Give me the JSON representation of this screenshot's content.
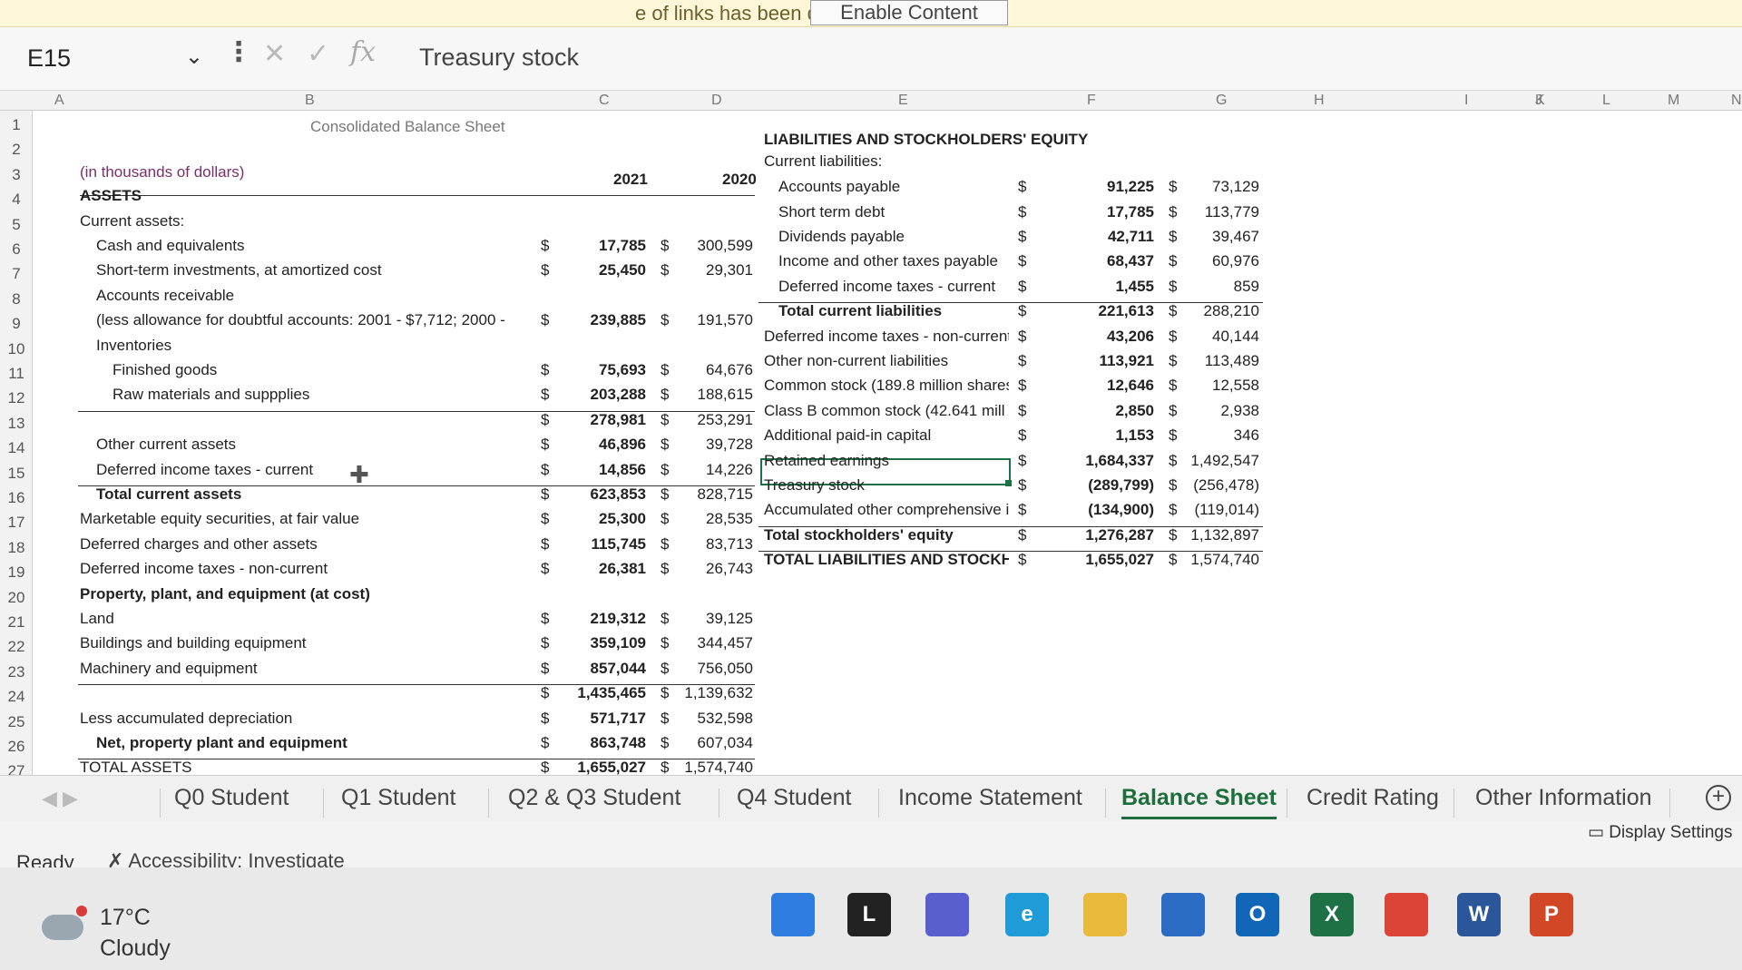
{
  "security_bar": {
    "message": "e of links has been disabled",
    "button": "Enable Content"
  },
  "formula_bar": {
    "name_box": "E15",
    "chevron": "⌄",
    "dots": "⋮",
    "cancel": "✕",
    "enter": "✓",
    "fx": "fx",
    "formula": "Treasury stock"
  },
  "columns": [
    "A",
    "B",
    "C",
    "D",
    "E",
    "F",
    "G",
    "H",
    "I",
    "J",
    "K",
    "L",
    "M",
    "N"
  ],
  "rows": [
    "1",
    "2",
    "3",
    "4",
    "5",
    "6",
    "7",
    "8",
    "9",
    "10",
    "11",
    "12",
    "13",
    "14",
    "15",
    "16",
    "17",
    "18",
    "19",
    "20",
    "21",
    "22",
    "23",
    "24",
    "25",
    "26",
    "27"
  ],
  "assets": {
    "title": "Consolidated Balance Sheet",
    "units": "(in thousands of dollars)",
    "year1": "2021",
    "year2": "2020",
    "lines": [
      {
        "label": "ASSETS",
        "bold": true,
        "indent": 0,
        "v1": "",
        "v2": ""
      },
      {
        "label": "Current assets:",
        "bold": false,
        "indent": 0,
        "v1": "",
        "v2": ""
      },
      {
        "label": "Cash and equivalents",
        "bold": false,
        "indent": 1,
        "v1": "17,785",
        "v2": "300,599"
      },
      {
        "label": "Short-term investments, at amortized cost",
        "bold": false,
        "indent": 1,
        "v1": "25,450",
        "v2": "29,301"
      },
      {
        "label": "Accounts receivable",
        "bold": false,
        "indent": 1,
        "v1": "",
        "v2": ""
      },
      {
        "label": "(less allowance for doubtful accounts: 2001 - $7,712; 2000 -",
        "bold": false,
        "indent": 1,
        "v1": "239,885",
        "v2": "191,570"
      },
      {
        "label": "Inventories",
        "bold": false,
        "indent": 1,
        "v1": "",
        "v2": ""
      },
      {
        "label": "Finished goods",
        "bold": false,
        "indent": 2,
        "v1": "75,693",
        "v2": "64,676"
      },
      {
        "label": "Raw materials and suppplies",
        "bold": false,
        "indent": 2,
        "v1": "203,288",
        "v2": "188,615"
      },
      {
        "label": "",
        "bold": false,
        "indent": 0,
        "v1": "278,981",
        "v2": "253,291"
      },
      {
        "label": "Other current assets",
        "bold": false,
        "indent": 1,
        "v1": "46,896",
        "v2": "39,728"
      },
      {
        "label": "Deferred income taxes - current",
        "bold": false,
        "indent": 1,
        "v1": "14,856",
        "v2": "14,226"
      },
      {
        "label": "Total current assets",
        "bold": true,
        "indent": 1,
        "v1": "623,853",
        "v2": "828,715"
      },
      {
        "label": "Marketable equity securities, at fair value",
        "bold": false,
        "indent": 0,
        "v1": "25,300",
        "v2": "28,535"
      },
      {
        "label": "Deferred charges and other assets",
        "bold": false,
        "indent": 0,
        "v1": "115,745",
        "v2": "83,713"
      },
      {
        "label": "Deferred income taxes - non-current",
        "bold": false,
        "indent": 0,
        "v1": "26,381",
        "v2": "26,743"
      },
      {
        "label": "Property, plant, and equipment (at cost)",
        "bold": true,
        "indent": 0,
        "v1": "",
        "v2": ""
      },
      {
        "label": "Land",
        "bold": false,
        "indent": 0,
        "v1": "219,312",
        "v2": "39,125"
      },
      {
        "label": "Buildings and building equipment",
        "bold": false,
        "indent": 0,
        "v1": "359,109",
        "v2": "344,457"
      },
      {
        "label": "Machinery and equipment",
        "bold": false,
        "indent": 0,
        "v1": "857,044",
        "v2": "756,050"
      },
      {
        "label": "",
        "bold": false,
        "indent": 0,
        "v1": "1,435,465",
        "v2": "1,139,632"
      },
      {
        "label": "Less accumulated depreciation",
        "bold": false,
        "indent": 0,
        "v1": "571,717",
        "v2": "532,598"
      },
      {
        "label": "Net, property plant and equipment",
        "bold": true,
        "indent": 1,
        "v1": "863,748",
        "v2": "607,034"
      },
      {
        "label": "TOTAL ASSETS",
        "bold": false,
        "indent": 0,
        "v1": "1,655,027",
        "v2": "1,574,740"
      }
    ]
  },
  "liabilities": {
    "title": "LIABILITIES AND STOCKHOLDERS' EQUITY",
    "subtitle": "Current liabilities:",
    "lines": [
      {
        "label": "Accounts payable",
        "bold": false,
        "indent": 1,
        "v1": "91,225",
        "v2": "73,129"
      },
      {
        "label": "Short term debt",
        "bold": false,
        "indent": 1,
        "v1": "17,785",
        "v2": "113,779"
      },
      {
        "label": "Dividends payable",
        "bold": false,
        "indent": 1,
        "v1": "42,711",
        "v2": "39,467"
      },
      {
        "label": "Income and other taxes payable",
        "bold": false,
        "indent": 1,
        "v1": "68,437",
        "v2": "60,976"
      },
      {
        "label": "Deferred income taxes - current",
        "bold": false,
        "indent": 1,
        "v1": "1,455",
        "v2": "859"
      },
      {
        "label": "Total current liabilities",
        "bold": true,
        "indent": 1,
        "v1": "221,613",
        "v2": "288,210"
      },
      {
        "label": "Deferred income taxes - non-current",
        "bold": false,
        "indent": 0,
        "v1": "43,206",
        "v2": "40,144"
      },
      {
        "label": "Other non-current liabilities",
        "bold": false,
        "indent": 0,
        "v1": "113,921",
        "v2": "113,489"
      },
      {
        "label": "Common stock (189.8 million shares",
        "bold": false,
        "indent": 0,
        "v1": "12,646",
        "v2": "12,558"
      },
      {
        "label": "Class B common stock (42.641 mill",
        "bold": false,
        "indent": 0,
        "v1": "2,850",
        "v2": "2,938"
      },
      {
        "label": "Additional paid-in capital",
        "bold": false,
        "indent": 0,
        "v1": "1,153",
        "v2": "346"
      },
      {
        "label": "Retained earnings",
        "bold": false,
        "indent": 0,
        "v1": "1,684,337",
        "v2": "1,492,547"
      },
      {
        "label": "Treasury stock",
        "bold": false,
        "indent": 0,
        "v1": "(289,799)",
        "v2": "(256,478)"
      },
      {
        "label": "Accumulated other comprehensive i",
        "bold": false,
        "indent": 0,
        "v1": "(134,900)",
        "v2": "(119,014)"
      },
      {
        "label": "Total stockholders' equity",
        "bold": true,
        "indent": 0,
        "v1": "1,276,287",
        "v2": "1,132,897"
      },
      {
        "label": "TOTAL LIABILITIES AND STOCKH",
        "bold": true,
        "indent": 0,
        "v1": "1,655,027",
        "v2": "1,574,740"
      }
    ]
  },
  "currency": "$",
  "tabs": [
    "Q0 Student",
    "Q1 Student",
    "Q2 & Q3 Student",
    "Q4 Student",
    "Income Statement",
    "Balance Sheet",
    "Credit Rating",
    "Other Information"
  ],
  "active_tab": "Balance Sheet",
  "add_sheet": "+",
  "status": {
    "ready": "Ready",
    "accessibility": "Accessibility: Investigate",
    "display_settings": "Display Settings"
  },
  "weather": {
    "temp": "17°C",
    "condition": "Cloudy"
  },
  "taskbar_apps": [
    {
      "name": "windows-start",
      "color": "#2f7de1",
      "letter": ""
    },
    {
      "name": "app-l",
      "color": "#222222",
      "letter": "L"
    },
    {
      "name": "chat",
      "color": "#5a5fd0",
      "letter": ""
    },
    {
      "name": "edge",
      "color": "#1f9bd8",
      "letter": "e"
    },
    {
      "name": "file-explorer",
      "color": "#e8b93a",
      "letter": ""
    },
    {
      "name": "mail",
      "color": "#2b6cc4",
      "letter": ""
    },
    {
      "name": "outlook",
      "color": "#1166b8",
      "letter": "O"
    },
    {
      "name": "excel",
      "color": "#1e7145",
      "letter": "X"
    },
    {
      "name": "chrome",
      "color": "#db4437",
      "letter": ""
    },
    {
      "name": "word",
      "color": "#2b579a",
      "letter": "W"
    },
    {
      "name": "powerpoint",
      "color": "#d24726",
      "letter": "P"
    }
  ]
}
